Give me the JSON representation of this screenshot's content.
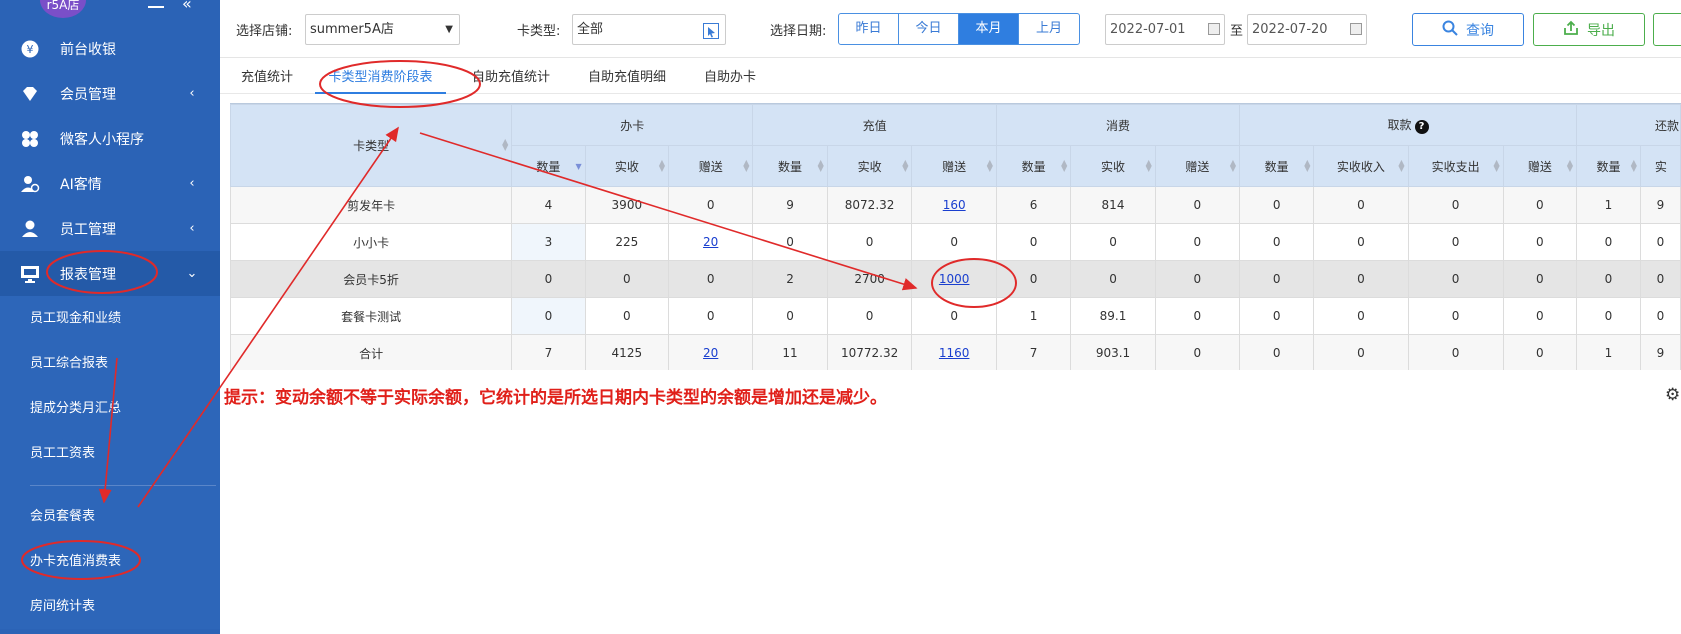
{
  "sidebar": {
    "store_badge": "r5A店",
    "items": [
      {
        "label": "前台收银",
        "icon": "yen-icon",
        "chevron": ""
      },
      {
        "label": "会员管理",
        "icon": "diamond-icon",
        "chevron": "‹"
      },
      {
        "label": "微客人小程序",
        "icon": "clover-icon",
        "chevron": ""
      },
      {
        "label": "AI客情",
        "icon": "user-ai-icon",
        "chevron": "‹"
      },
      {
        "label": "员工管理",
        "icon": "person-icon",
        "chevron": "‹"
      },
      {
        "label": "报表管理",
        "icon": "monitor-icon",
        "chevron": "⌄"
      }
    ],
    "sub_items": [
      {
        "label": "员工现金和业绩"
      },
      {
        "label": "员工综合报表"
      },
      {
        "label": "提成分类月汇总"
      },
      {
        "label": "员工工资表"
      },
      {
        "label": "会员套餐表"
      },
      {
        "label": "办卡充值消费表"
      },
      {
        "label": "房间统计表"
      }
    ]
  },
  "toolbar": {
    "store_label": "选择店铺:",
    "store_value": "summer5A店",
    "card_type_label": "卡类型:",
    "card_type_value": "全部",
    "date_label": "选择日期:",
    "date_buttons": [
      "昨日",
      "今日",
      "本月",
      "上月"
    ],
    "date_active": "本月",
    "date_from": "2022-07-01",
    "date_sep": "至",
    "date_to": "2022-07-20",
    "query_label": "查询",
    "export_label": "导出"
  },
  "tabs": [
    "充值统计",
    "卡类型消费阶段表",
    "自助充值统计",
    "自助充值明细",
    "自助办卡"
  ],
  "active_tab": "卡类型消费阶段表",
  "table": {
    "type_header": "卡类型",
    "groups": [
      "办卡",
      "充值",
      "消费",
      "取款",
      "还款"
    ],
    "sub_headers": {
      "open": [
        "数量",
        "实收",
        "赠送"
      ],
      "recharge": [
        "数量",
        "实收",
        "赠送"
      ],
      "consume": [
        "数量",
        "实收",
        "赠送"
      ],
      "withdraw": [
        "数量",
        "实收收入",
        "实收支出",
        "赠送"
      ],
      "repay": [
        "数量",
        "实"
      ]
    },
    "rows": [
      {
        "name": "剪发年卡",
        "cells": [
          "4",
          "3900",
          "0",
          "9",
          "8072.32",
          "160",
          "6",
          "814",
          "0",
          "0",
          "0",
          "0",
          "0",
          "1",
          "9"
        ]
      },
      {
        "name": "小小卡",
        "cells": [
          "3",
          "225",
          "20",
          "0",
          "0",
          "0",
          "0",
          "0",
          "0",
          "0",
          "0",
          "0",
          "0",
          "0",
          "0"
        ]
      },
      {
        "name": "会员卡5折",
        "cells": [
          "0",
          "0",
          "0",
          "2",
          "2700",
          "1000",
          "0",
          "0",
          "0",
          "0",
          "0",
          "0",
          "0",
          "0",
          "0"
        ]
      },
      {
        "name": "套餐卡测试",
        "cells": [
          "0",
          "0",
          "0",
          "0",
          "0",
          "0",
          "1",
          "89.1",
          "0",
          "0",
          "0",
          "0",
          "0",
          "0",
          "0"
        ]
      },
      {
        "name": "合计",
        "cells": [
          "7",
          "4125",
          "20",
          "11",
          "10772.32",
          "1160",
          "7",
          "903.1",
          "0",
          "0",
          "0",
          "0",
          "0",
          "1",
          "9"
        ]
      }
    ]
  },
  "hint": "提示：变动余额不等于实际余额，它统计的是所选日期内卡类型的余额是增加还是减少。",
  "colors": {
    "sidebar": "#2b63b6",
    "accent": "#2f7ee0",
    "annotation": "#e02a2a",
    "export": "#4cae4c"
  }
}
